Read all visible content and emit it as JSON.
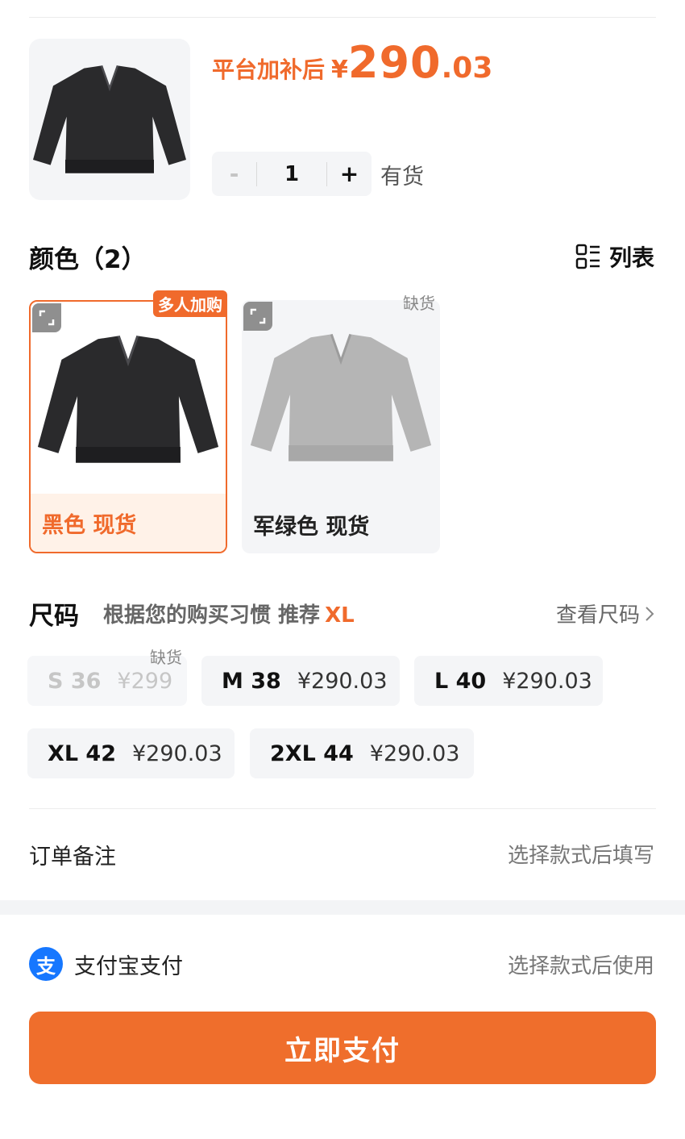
{
  "product": {
    "price_label": "平台加补后",
    "currency": "¥",
    "price_int": "290",
    "price_dec": ".03",
    "quantity": "1",
    "minus": "-",
    "plus": "+",
    "stock": "有货"
  },
  "colors": {
    "title": "颜色（2）",
    "list_label": "列表",
    "options": [
      {
        "label": "黑色 现货",
        "badge": "多人加购",
        "selected": true,
        "swatch": "#2a2a2c"
      },
      {
        "label": "军绿色 现货",
        "badge": "缺货",
        "selected": false,
        "swatch": "#b5b5b5"
      }
    ]
  },
  "size": {
    "title": "尺码",
    "reco_text": "根据您的购买习惯 推荐",
    "reco_value": "XL",
    "chart_link": "查看尺码",
    "options": [
      {
        "size": "S 36",
        "price": "¥299",
        "badge": "缺货",
        "available": false
      },
      {
        "size": "M 38",
        "price": "¥290.03",
        "available": true
      },
      {
        "size": "L 40",
        "price": "¥290.03",
        "available": true
      },
      {
        "size": "XL 42",
        "price": "¥290.03",
        "available": true
      },
      {
        "size": "2XL 44",
        "price": "¥290.03",
        "available": true
      }
    ]
  },
  "order_note": {
    "label": "订单备注",
    "hint": "选择款式后填写"
  },
  "payment": {
    "icon_char": "支",
    "method": "支付宝支付",
    "hint": "选择款式后使用",
    "button": "立即支付"
  },
  "colors_theme": {
    "accent": "#f06a2c",
    "alipay_blue": "#1677ff"
  }
}
